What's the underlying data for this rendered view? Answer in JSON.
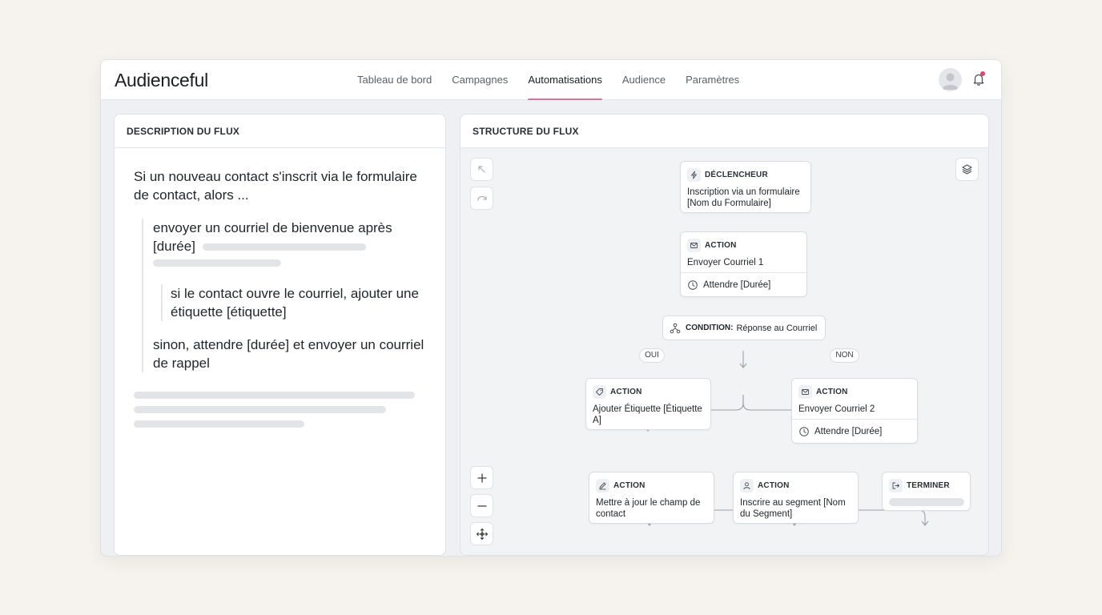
{
  "app": {
    "logo": "Audienceful"
  },
  "nav": [
    {
      "label": "Tableau de bord",
      "active": false
    },
    {
      "label": "Campagnes",
      "active": false
    },
    {
      "label": "Automatisations",
      "active": true
    },
    {
      "label": "Audience",
      "active": false
    },
    {
      "label": "Paramètres",
      "active": false
    }
  ],
  "colors": {
    "accent": "#d9739a",
    "notification": "#e0446a"
  },
  "left_panel": {
    "title": "DESCRIPTION DU FLUX",
    "intro": "Si un nouveau contact s'inscrit via le formulaire de contact, alors ...",
    "step1": "envoyer un courriel de bienvenue après [durée]",
    "step2": "si le contact ouvre le courriel, ajouter une étiquette [étiquette]",
    "step3": "sinon, attendre [durée] et envoyer un courriel de rappel"
  },
  "right_panel": {
    "title": "STRUCTURE DU FLUX",
    "trigger": {
      "type": "DÉCLENCHEUR",
      "text": "Inscription via un formulaire [Nom du Formulaire]"
    },
    "action1": {
      "type": "ACTION",
      "text": "Envoyer Courriel 1",
      "wait": "Attendre [Durée]"
    },
    "condition": {
      "label": "CONDITION:",
      "text": "Réponse au Courriel"
    },
    "yes_label": "OUI",
    "no_label": "NON",
    "action_yes": {
      "type": "ACTION",
      "text": "Ajouter Étiquette [Étiquette A]"
    },
    "action_no": {
      "type": "ACTION",
      "text": "Envoyer Courriel 2",
      "wait": "Attendre [Durée]"
    },
    "action_update": {
      "type": "ACTION",
      "text": "Mettre à jour le champ de contact"
    },
    "action_segment": {
      "type": "ACTION",
      "text": "Inscrire au segment [Nom du Segment]"
    },
    "end": {
      "type": "TERMINER"
    }
  },
  "icons": {
    "undo": "undo-icon",
    "redo": "redo-icon",
    "layers": "layers-icon",
    "zoom_in": "plus-icon",
    "zoom_out": "minus-icon",
    "fit": "move-icon",
    "bell": "bell-icon",
    "avatar": "user-avatar"
  }
}
